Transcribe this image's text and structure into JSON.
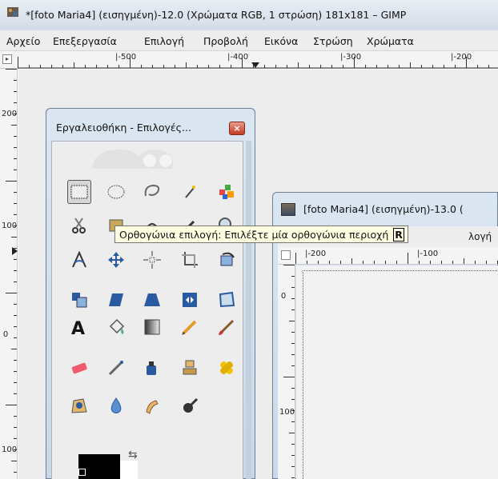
{
  "window": {
    "title": "*[foto Maria4] (εισηγμένη)-12.0 (Χρώματα RGB, 1 στρώση) 181x181 – GIMP"
  },
  "menubar": [
    {
      "label": "Αρχείο"
    },
    {
      "label": "Επεξεργασία"
    },
    {
      "label": "Επιλογή"
    },
    {
      "label": "Προβολή"
    },
    {
      "label": "Εικόνα"
    },
    {
      "label": "Στρώση"
    },
    {
      "label": "Χρώματα"
    }
  ],
  "ruler_top": [
    "|-500",
    "|-400",
    "|-300",
    "|-200"
  ],
  "ruler_left": [
    "200",
    "100",
    "0",
    "100"
  ],
  "toolbox": {
    "title": "Εργαλειοθήκη - Επιλογές...",
    "close": "×",
    "tools": [
      {
        "name": "rect-select-icon",
        "active": true
      },
      {
        "name": "ellipse-select-icon"
      },
      {
        "name": "free-select-icon"
      },
      {
        "name": "fuzzy-select-icon"
      },
      {
        "name": "color-select-icon"
      },
      {
        "name": "scissors-select-icon"
      },
      {
        "name": "foreground-select-icon"
      },
      {
        "name": "paths-icon"
      },
      {
        "name": "color-picker-icon"
      },
      {
        "name": "zoom-icon"
      },
      {
        "name": "measure-icon"
      },
      {
        "name": "move-icon"
      },
      {
        "name": "align-icon"
      },
      {
        "name": "crop-icon"
      },
      {
        "name": "rotate-icon"
      },
      {
        "name": "scale-icon"
      },
      {
        "name": "shear-icon"
      },
      {
        "name": "perspective-icon"
      },
      {
        "name": "flip-icon"
      },
      {
        "name": "cage-transform-icon"
      },
      {
        "name": "text-icon"
      },
      {
        "name": "bucket-fill-icon"
      },
      {
        "name": "blend-icon"
      },
      {
        "name": "pencil-icon"
      },
      {
        "name": "paintbrush-icon"
      },
      {
        "name": "eraser-icon"
      },
      {
        "name": "airbrush-icon"
      },
      {
        "name": "ink-icon"
      },
      {
        "name": "clone-icon"
      },
      {
        "name": "heal-icon"
      },
      {
        "name": "perspective-clone-icon"
      },
      {
        "name": "blur-icon"
      },
      {
        "name": "smudge-icon"
      },
      {
        "name": "dodge-burn-icon"
      }
    ]
  },
  "tooltip": {
    "text": "Ορθογώνια επιλογή: Επιλέξτε μία ορθογώνια περιοχή",
    "shortcut": "R"
  },
  "image_window": {
    "title": "[foto Maria4] (εισηγμένη)-13.0 (",
    "menu_partial": "λογή",
    "ruler_top": [
      "|-200",
      "|-100"
    ],
    "ruler_left": [
      "0",
      "100"
    ]
  },
  "colors": {
    "foreground": "#000000",
    "background": "#ffffff"
  }
}
